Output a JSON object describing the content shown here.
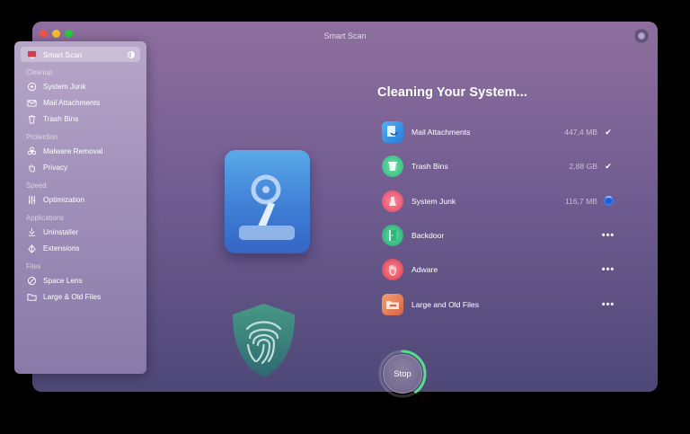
{
  "window": {
    "title": "Smart Scan"
  },
  "sidebar": {
    "smart_scan": "Smart Scan",
    "sections": {
      "cleanup": "Cleanup",
      "protection": "Protection",
      "speed": "Speed",
      "applications": "Applications",
      "files": "Files"
    },
    "items": {
      "system_junk": "System Junk",
      "mail_attachments": "Mail Attachments",
      "trash_bins": "Trash Bins",
      "malware_removal": "Malware Removal",
      "privacy": "Privacy",
      "optimization": "Optimization",
      "uninstaller": "Uninstaller",
      "extensions": "Extensions",
      "space_lens": "Space Lens",
      "large_old_files": "Large & Old Files"
    }
  },
  "main": {
    "heading": "Cleaning Your System...",
    "tasks": [
      {
        "name": "Mail Attachments",
        "size": "447,4 MB",
        "status": "done",
        "icon": "mail-attachments-icon"
      },
      {
        "name": "Trash Bins",
        "size": "2,88 GB",
        "status": "done",
        "icon": "trash-icon"
      },
      {
        "name": "System Junk",
        "size": "116,7 MB",
        "status": "in-progress",
        "icon": "system-junk-icon"
      },
      {
        "name": "Backdoor",
        "size": "",
        "status": "pending",
        "icon": "backdoor-icon"
      },
      {
        "name": "Adware",
        "size": "",
        "status": "pending",
        "icon": "adware-icon"
      },
      {
        "name": "Large and Old Files",
        "size": "",
        "status": "pending",
        "icon": "large-old-files-icon"
      }
    ],
    "status_glyphs": {
      "done": "✔",
      "pending": "•••"
    },
    "stop_label": "Stop",
    "stop_progress": 0.4
  },
  "colors": {
    "accent_green": "#52e08a",
    "accent_blue": "#2f7cf6"
  }
}
